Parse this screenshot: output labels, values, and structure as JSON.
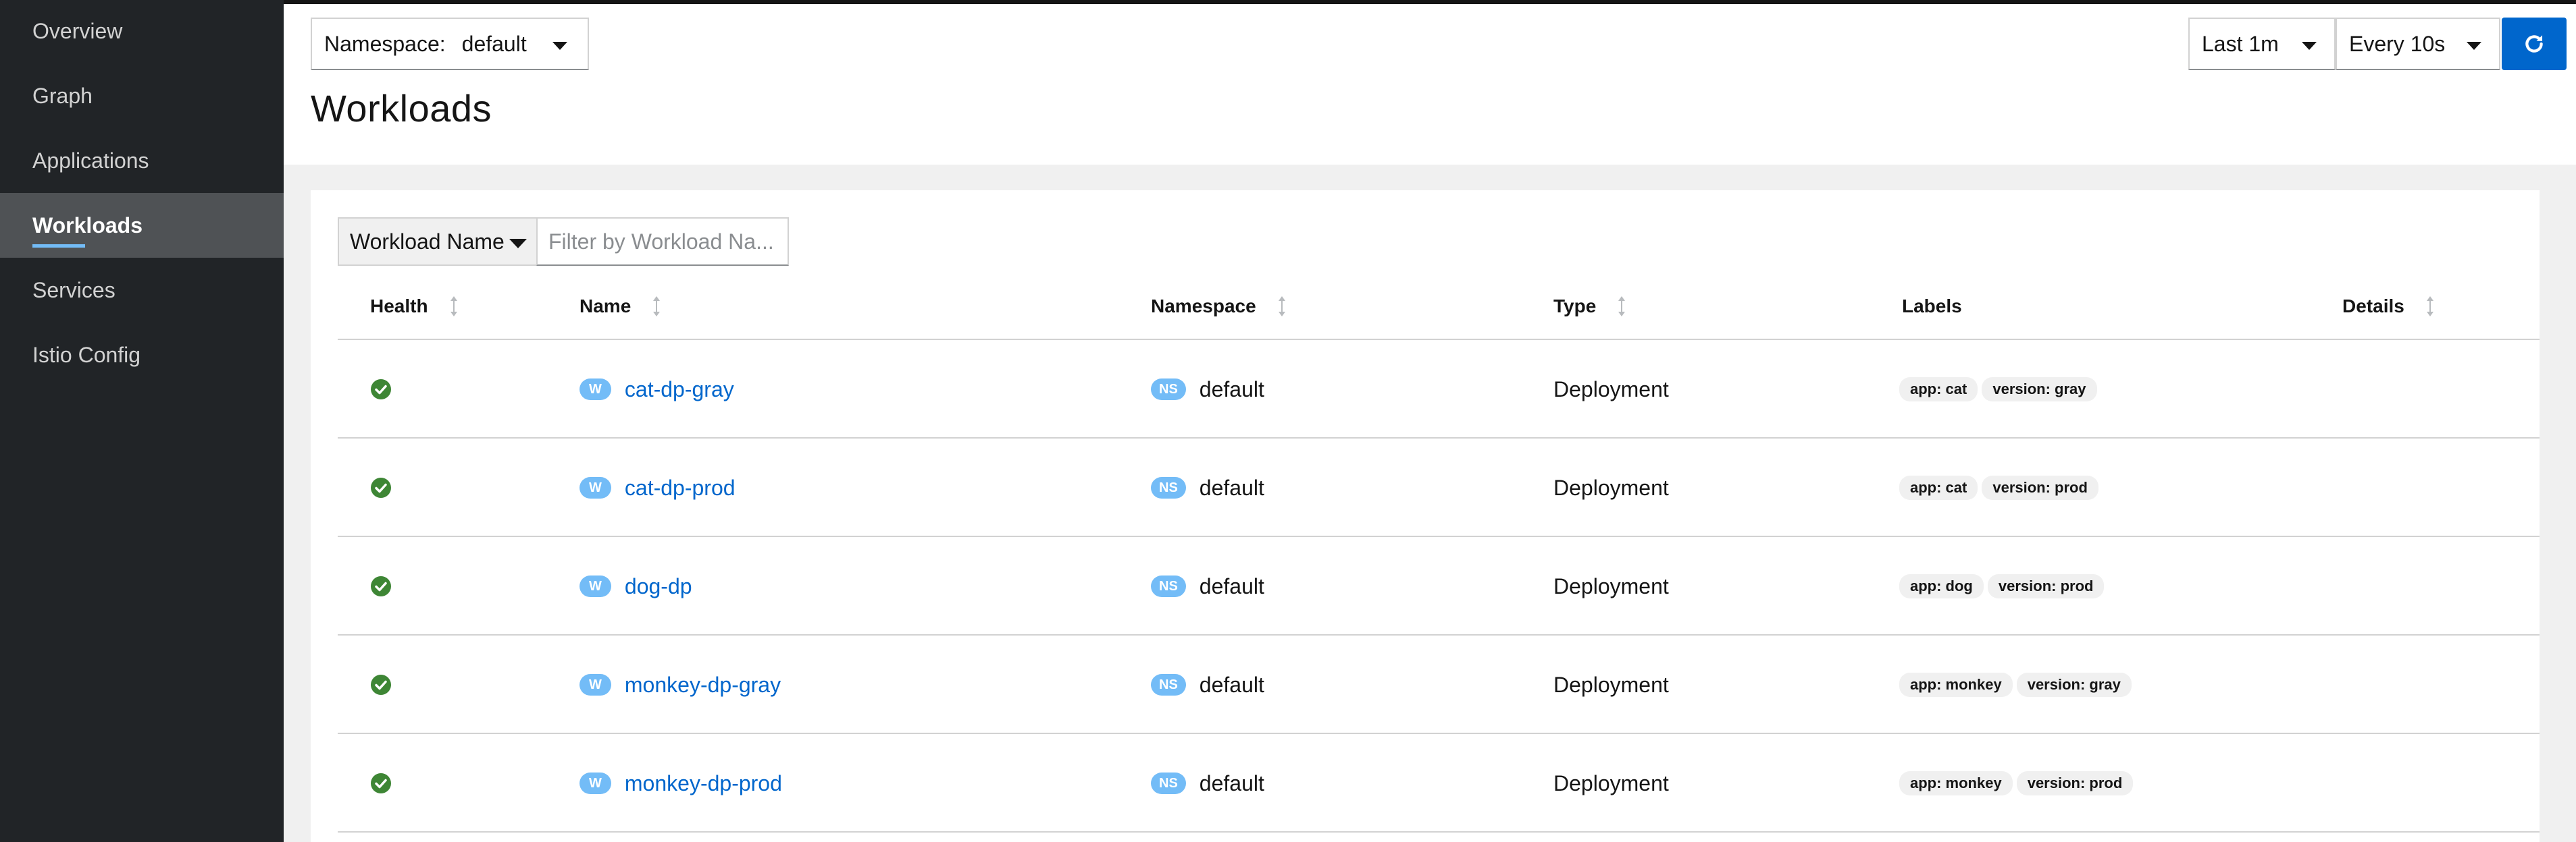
{
  "nav": [
    {
      "label": "Overview",
      "active": false
    },
    {
      "label": "Graph",
      "active": false
    },
    {
      "label": "Applications",
      "active": false
    },
    {
      "label": "Workloads",
      "active": true
    },
    {
      "label": "Services",
      "active": false
    },
    {
      "label": "Istio Config",
      "active": false
    }
  ],
  "header": {
    "namespace_label": "Namespace:",
    "namespace_value": "default",
    "title": "Workloads",
    "time_range": "Last 1m",
    "refresh_interval": "Every 10s",
    "refresh_icon": "refresh-icon"
  },
  "filter": {
    "type": "Workload Name",
    "placeholder": "Filter by Workload Na..."
  },
  "table": {
    "columns": [
      {
        "label": "Health",
        "sortable": true
      },
      {
        "label": "Name",
        "sortable": true
      },
      {
        "label": "Namespace",
        "sortable": true
      },
      {
        "label": "Type",
        "sortable": true
      },
      {
        "label": "Labels",
        "sortable": false
      },
      {
        "label": "Details",
        "sortable": true
      }
    ],
    "rows": [
      {
        "health": "healthy",
        "kind_badge": "W",
        "name": "cat-dp-gray",
        "ns_badge": "NS",
        "namespace": "default",
        "type": "Deployment",
        "labels": [
          "app: cat",
          "version: gray"
        ]
      },
      {
        "health": "healthy",
        "kind_badge": "W",
        "name": "cat-dp-prod",
        "ns_badge": "NS",
        "namespace": "default",
        "type": "Deployment",
        "labels": [
          "app: cat",
          "version: prod"
        ]
      },
      {
        "health": "healthy",
        "kind_badge": "W",
        "name": "dog-dp",
        "ns_badge": "NS",
        "namespace": "default",
        "type": "Deployment",
        "labels": [
          "app: dog",
          "version: prod"
        ]
      },
      {
        "health": "healthy",
        "kind_badge": "W",
        "name": "monkey-dp-gray",
        "ns_badge": "NS",
        "namespace": "default",
        "type": "Deployment",
        "labels": [
          "app: monkey",
          "version: gray"
        ]
      },
      {
        "health": "healthy",
        "kind_badge": "W",
        "name": "monkey-dp-prod",
        "ns_badge": "NS",
        "namespace": "default",
        "type": "Deployment",
        "labels": [
          "app: monkey",
          "version: prod"
        ]
      }
    ]
  },
  "colors": {
    "sidebar_bg": "#212427",
    "link": "#0066cc",
    "badge": "#73bcf7",
    "healthy": "#3e8635",
    "primary_button": "#0066cc"
  }
}
